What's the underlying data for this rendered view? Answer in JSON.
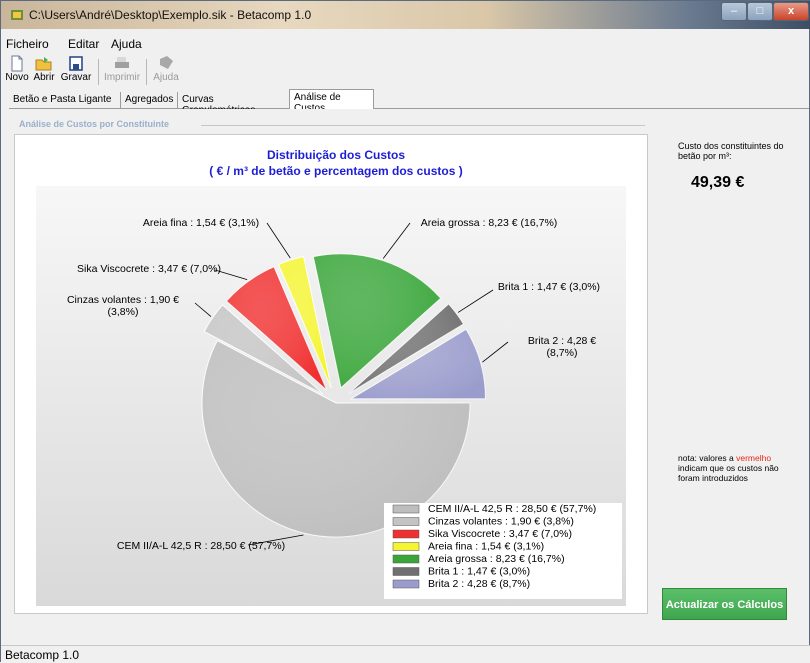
{
  "window": {
    "title": "C:\\Users\\André\\Desktop\\Exemplo.sik - Betacomp 1.0",
    "minimize": "–",
    "maximize": "□",
    "close": "x"
  },
  "menu": [
    "Ficheiro",
    "Editar",
    "Ajuda"
  ],
  "toolbar": {
    "novo": "Novo",
    "abrir": "Abrir",
    "gravar": "Gravar",
    "imprimir": "Imprimir",
    "ajuda": "Ajuda"
  },
  "tabs": [
    "Betão e Pasta Ligante",
    "Agregados",
    "Curvas Granulométricas",
    "Análise de Custos"
  ],
  "section_title": "Análise de Custos por Constituinte",
  "cost_panel": {
    "title": "Custo dos constituintes do betão por m³:",
    "value": "49,39 €"
  },
  "note": {
    "prefix": "nota: valores a ",
    "red_word": "vermelho",
    "suffix": " indicam que os custos não foram introduzidos"
  },
  "action_button": "Actualizar os Cálculos",
  "status": "Betacomp 1.0",
  "colors": {
    "accent_button": "#4cb35c",
    "chart_title": "#1d1dd6",
    "note_red": "#e8261a"
  },
  "chart_data": {
    "type": "pie",
    "title": "Distribuição dos Custos",
    "subtitle": "( € / m³ de betão e percentagem dos custos )",
    "unit": "€",
    "slices": [
      {
        "name": "CEM II/A-L 42,5 R",
        "value": 28.5,
        "percent": 57.7,
        "label": "CEM II/A-L 42,5 R : 28,50 €  (57,7%)",
        "legend": "CEM II/A-L 42,5 R : 28,50 €  (57,7%)",
        "color": "#bdbdbd"
      },
      {
        "name": "Cinzas volantes",
        "value": 1.9,
        "percent": 3.8,
        "label": "Cinzas volantes : 1,90 €\n(3,8%)",
        "legend": "Cinzas volantes : 1,90 €  (3,8%)",
        "color": "#c4c4c4"
      },
      {
        "name": "Sika Viscocrete",
        "value": 3.47,
        "percent": 7.0,
        "label": "Sika Viscocrete : 3,47 €  (7,0%)",
        "legend": "Sika Viscocrete : 3,47 €  (7,0%)",
        "color": "#f03030"
      },
      {
        "name": "Areia fina",
        "value": 1.54,
        "percent": 3.1,
        "label": "Areia fina : 1,54 €  (3,1%)",
        "legend": "Areia fina : 1,54 €  (3,1%)",
        "color": "#f4f431"
      },
      {
        "name": "Areia grossa",
        "value": 8.23,
        "percent": 16.7,
        "label": "Areia grossa : 8,23 €  (16,7%)",
        "legend": "Areia grossa : 8,23 €  (16,7%)",
        "color": "#3aa63a"
      },
      {
        "name": "Brita 1",
        "value": 1.47,
        "percent": 3.0,
        "label": "Brita 1 : 1,47 €  (3,0%)",
        "legend": "Brita 1 : 1,47 €  (3,0%)",
        "color": "#707070"
      },
      {
        "name": "Brita 2",
        "value": 4.28,
        "percent": 8.7,
        "label": "Brita 2 : 4,28 €\n(8,7%)",
        "legend": "Brita 2 : 4,28 €  (8,7%)",
        "color": "#9a9ccc"
      }
    ]
  }
}
